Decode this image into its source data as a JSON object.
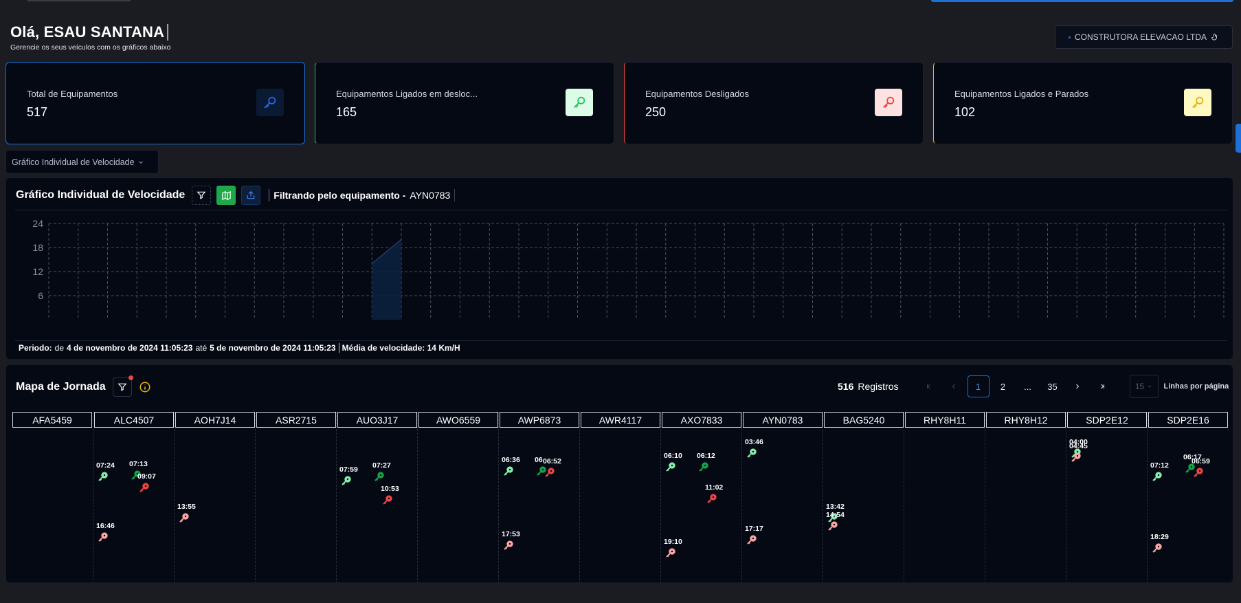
{
  "greeting": {
    "title": "Olá, ESAU SANTANA",
    "subtitle": "Gerencie os seus veículos com os gráficos abaixo"
  },
  "company": {
    "label": "CONSTRUTORA ELEVACAO LTDA"
  },
  "cards": [
    {
      "label": "Total de Equipamentos",
      "value": "517",
      "icon": "key-icon",
      "color": "#2563eb"
    },
    {
      "label": "Equipamentos Ligados em desloc...",
      "value": "165",
      "icon": "key-icon",
      "color": "#22c55e"
    },
    {
      "label": "Equipamentos Desligados",
      "value": "250",
      "icon": "key-icon",
      "color": "#ef4444"
    },
    {
      "label": "Equipamentos Ligados e Parados",
      "value": "102",
      "icon": "key-icon",
      "color": "#eab308"
    }
  ],
  "chart_select": {
    "value": "Gráfico Individual de Velocidade"
  },
  "chart_panel": {
    "title": "Gráfico Individual de Velocidade",
    "filter_prefix": "Filtrando pelo equipamento -",
    "filter_equipment": "AYN0783",
    "period": {
      "label": "Periodo:",
      "from_word": "de",
      "from": "4 de novembro de 2024 11:05:23",
      "to_word": "até",
      "to": "5 de novembro de 2024 11:05:23",
      "avg": "Média de velocidade: 14 Km/H"
    }
  },
  "chart_data": {
    "type": "area",
    "title": "Gráfico Individual de Velocidade",
    "ylim": [
      0,
      24
    ],
    "yticks": [
      6,
      12,
      18,
      24
    ],
    "grid": true,
    "x_slots": 40,
    "series": [
      {
        "slot_from": 11,
        "slot_to": 12,
        "values": [
          14,
          20
        ]
      }
    ]
  },
  "map_panel": {
    "title": "Mapa de Jornada",
    "records_count": "516",
    "records_label": "Registros",
    "pages": [
      "1",
      "2",
      "...",
      "35"
    ],
    "active_page": "1",
    "per_page": "15",
    "per_page_label": "Linhas por página",
    "columns": [
      {
        "name": "AFA5459",
        "events": []
      },
      {
        "name": "ALC4507",
        "events": [
          {
            "time": "07:24",
            "status": "moving"
          },
          {
            "time": "07:13",
            "status": "on"
          },
          {
            "time": "09:07",
            "status": "off"
          },
          {
            "time": "16:46",
            "status": "off-light"
          }
        ]
      },
      {
        "name": "AOH7J14",
        "events": [
          {
            "time": "13:55",
            "status": "off-light"
          }
        ]
      },
      {
        "name": "ASR2715",
        "events": []
      },
      {
        "name": "AUO3J17",
        "events": [
          {
            "time": "07:59",
            "status": "moving"
          },
          {
            "time": "07:27",
            "status": "on"
          },
          {
            "time": "10:53",
            "status": "off"
          }
        ]
      },
      {
        "name": "AWO6559",
        "events": []
      },
      {
        "name": "AWP6873",
        "events": [
          {
            "time": "06:36",
            "status": "moving"
          },
          {
            "time": "06",
            "status": "on"
          },
          {
            "time": "06:52",
            "status": "off"
          },
          {
            "time": "17:53",
            "status": "off-light"
          }
        ]
      },
      {
        "name": "AWR4117",
        "events": []
      },
      {
        "name": "AXO7833",
        "events": [
          {
            "time": "06:10",
            "status": "moving"
          },
          {
            "time": "06:12",
            "status": "on"
          },
          {
            "time": "11:02",
            "status": "off"
          },
          {
            "time": "19:10",
            "status": "off-light"
          }
        ]
      },
      {
        "name": "AYN0783",
        "events": [
          {
            "time": "03:46",
            "status": "moving"
          },
          {
            "time": "17:17",
            "status": "off-light"
          }
        ]
      },
      {
        "name": "BAG5240",
        "events": [
          {
            "time": "13:42",
            "status": "moving"
          },
          {
            "time": "14:54",
            "status": "off-light"
          }
        ]
      },
      {
        "name": "RHY8H11",
        "events": []
      },
      {
        "name": "RHY8H12",
        "events": []
      },
      {
        "name": "SDP2E12",
        "events": [
          {
            "time": "04:00",
            "status": "moving"
          },
          {
            "time": "04:45",
            "status": "off-light"
          }
        ]
      },
      {
        "name": "SDP2E16",
        "events": [
          {
            "time": "07:12",
            "status": "moving"
          },
          {
            "time": "06:17",
            "status": "on"
          },
          {
            "time": "06:59",
            "status": "off"
          },
          {
            "time": "18:29",
            "status": "off-light"
          }
        ]
      }
    ]
  },
  "status_colors": {
    "moving": "#86efac",
    "on": "#16a34a",
    "off": "#ef4444",
    "off-light": "#fca5a5"
  }
}
